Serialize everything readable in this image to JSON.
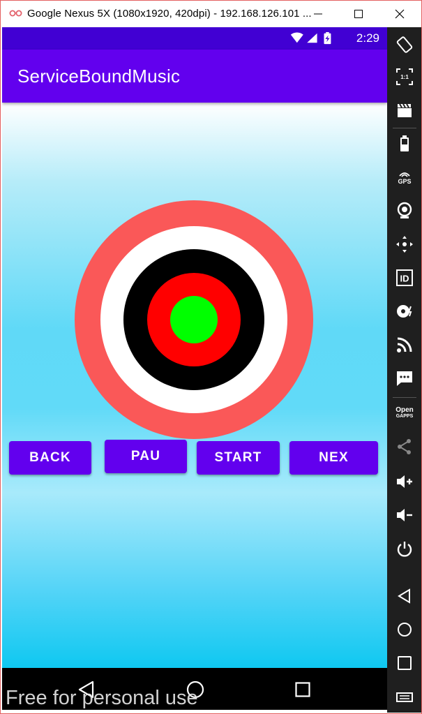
{
  "window": {
    "title": "Google Nexus 5X (1080x1920, 420dpi) - 192.168.126.101 ...",
    "icon": "genymotion-logo-icon",
    "controls": [
      "minimize-icon",
      "maximize-icon",
      "close-icon"
    ]
  },
  "statusbar": {
    "time": "2:29",
    "icons": [
      "wifi-icon",
      "cell-signal-icon",
      "battery-charging-icon"
    ]
  },
  "app": {
    "title": "ServiceBoundMusic"
  },
  "colors": {
    "appbar": "#6200ee",
    "statusbar": "#4100d3",
    "button": "#6200ee",
    "ring_outer": "#fa5858",
    "ring_white": "#ffffff",
    "ring_black": "#000000",
    "ring_red": "#ff0000",
    "center": "#00ff00"
  },
  "buttons": {
    "back": "BACK",
    "pause": "PAU",
    "start": "START",
    "next": "NEX"
  },
  "navbar": [
    "back-icon",
    "home-icon",
    "recents-icon"
  ],
  "sidebar": {
    "items": [
      "rotate-icon",
      "pixel-perfect-icon",
      "screencast-icon",
      "battery-icon",
      "gps-icon",
      "webcam-icon",
      "dpad-icon",
      "device-id-icon",
      "disk-io-icon",
      "network-icon",
      "sms-icon",
      "open-gapps-icon",
      "share-icon",
      "volume-up-icon",
      "volume-down-icon",
      "power-icon",
      "back-icon",
      "home-icon",
      "recents-icon",
      "menu-icon"
    ],
    "labels": {
      "pixel_perfect": "1:1",
      "gps": "GPS",
      "id": "ID",
      "open": "Open",
      "gapps": "GAPPS"
    }
  },
  "watermark": "Free for personal use"
}
